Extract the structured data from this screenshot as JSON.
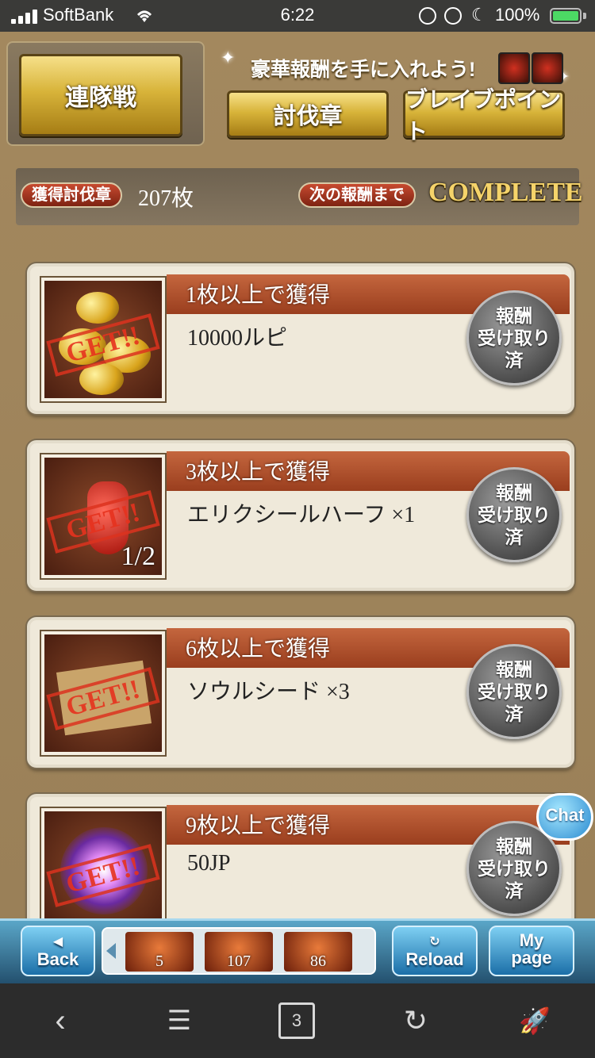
{
  "status": {
    "carrier": "SoftBank",
    "time": "6:22",
    "battery": "100%"
  },
  "header": {
    "rental_label": "連隊戦",
    "banner_text": "豪華報酬を手に入れよう!",
    "tab_medal": "討伐章",
    "tab_brave": "ブレイブポイント"
  },
  "info": {
    "got_label": "獲得討伐章",
    "got_value": "207枚",
    "next_label": "次の報酬まで",
    "next_value": "COMPLETE"
  },
  "rewards": [
    {
      "requirement": "1枚以上で獲得",
      "name": "10000ルピ",
      "stamp": "GET!!",
      "status_line1": "報酬",
      "status_line2": "受け取り済"
    },
    {
      "requirement": "3枚以上で獲得",
      "name": "エリクシールハーフ ×1",
      "stamp": "GET!!",
      "overlay": "1/2",
      "status_line1": "報酬",
      "status_line2": "受け取り済"
    },
    {
      "requirement": "6枚以上で獲得",
      "name": "ソウルシード ×3",
      "stamp": "GET!!",
      "status_line1": "報酬",
      "status_line2": "受け取り済"
    },
    {
      "requirement": "9枚以上で獲得",
      "name": "50JP",
      "stamp": "GET!!",
      "status_line1": "報酬",
      "status_line2": "受け取り済"
    }
  ],
  "chat_label": "Chat",
  "game_menu": {
    "back": "Back",
    "reload": "Reload",
    "mypage_line1": "My",
    "mypage_line2": "page",
    "items": [
      "5",
      "107",
      "86"
    ]
  },
  "browser": {
    "tab_count": "3"
  }
}
